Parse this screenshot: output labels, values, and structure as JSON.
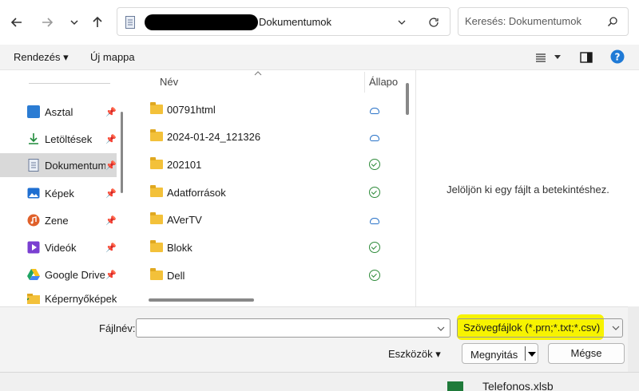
{
  "nav": {
    "back_icon": "arrow-left",
    "forward_icon": "arrow-right",
    "recent_icon": "chevron-down",
    "up_icon": "arrow-up"
  },
  "address": {
    "path_label": "Dokumentumok"
  },
  "search": {
    "placeholder": "Keresés: Dokumentumok"
  },
  "toolbar": {
    "organize_label": "Rendezés ▾",
    "new_folder_label": "Új mappa"
  },
  "sidebar": {
    "items": [
      {
        "label": "Asztal",
        "icon": "desktop-icon",
        "color": "#2b7cd3"
      },
      {
        "label": "Letöltések",
        "icon": "download-icon",
        "color": "#1f8a3a"
      },
      {
        "label": "Dokumentumok",
        "icon": "document-icon",
        "color": "#6a7b99"
      },
      {
        "label": "Képek",
        "icon": "pictures-icon",
        "color": "#1f6fd1"
      },
      {
        "label": "Zene",
        "icon": "music-icon",
        "color": "#e0602a"
      },
      {
        "label": "Videók",
        "icon": "videos-icon",
        "color": "#7a3fd1"
      },
      {
        "label": "Google Drive",
        "icon": "google-drive-icon",
        "color": "#1fa463"
      },
      {
        "label": "Képernyőképek",
        "icon": "folder-icon",
        "color": "#f3c13a"
      }
    ]
  },
  "filelist": {
    "columns": {
      "name": "Név",
      "status": "Állapo"
    },
    "rows": [
      {
        "name": "00791html",
        "status": "cloud"
      },
      {
        "name": "2024-01-24_121326",
        "status": "cloud"
      },
      {
        "name": "202101",
        "status": "synced"
      },
      {
        "name": "Adatforrások",
        "status": "synced"
      },
      {
        "name": "AVerTV",
        "status": "cloud"
      },
      {
        "name": "Blokk",
        "status": "synced"
      },
      {
        "name": "Dell",
        "status": "synced"
      }
    ]
  },
  "preview": {
    "message": "Jelöljön ki egy fájlt a betekintéshez."
  },
  "bottom": {
    "filename_label": "Fájlnév:",
    "filename_value": "",
    "filetype_label": "Szövegfájlok (*.prn;*.txt;*.csv)",
    "tools_label": "Eszközök ▾",
    "open_label": "Megnyitás",
    "cancel_label": "Mégse"
  },
  "background": {
    "file_label": "Telefonos.xlsb"
  },
  "colors": {
    "highlight": "#f7f300",
    "accent": "#2b7cd3",
    "synced": "#2e8b3a"
  }
}
